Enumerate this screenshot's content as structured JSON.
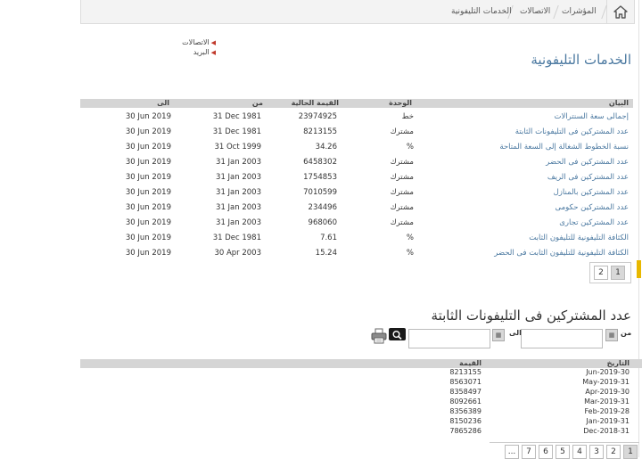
{
  "breadcrumb": {
    "items": [
      "المؤشرات",
      "الاتصالات",
      "الخدمات التليفونية"
    ]
  },
  "side_links": [
    "الاتصالات",
    "البريد"
  ],
  "page_title": "الخدمات التليفونية",
  "table": {
    "headers": {
      "item": "البيان",
      "unit": "الوحدة",
      "value": "القيمة الحالية",
      "from": "من",
      "to": "الى"
    },
    "rows": [
      {
        "item": "إجمالى سعة السنترالات",
        "unit": "خط",
        "value": "23974925",
        "from": "31 Dec 1981",
        "to": "30 Jun 2019"
      },
      {
        "item": "عدد المشتركين فى التليفونات الثابتة",
        "unit": "مشترك",
        "value": "8213155",
        "from": "31 Dec 1981",
        "to": "30 Jun 2019"
      },
      {
        "item": "نسبة الخطوط الشغالة إلى السعة المتاحة",
        "unit": "%",
        "value": "34.26",
        "from": "31 Oct 1999",
        "to": "30 Jun 2019"
      },
      {
        "item": "عدد المشتركين فى الحضر",
        "unit": "مشترك",
        "value": "6458302",
        "from": "31 Jan 2003",
        "to": "30 Jun 2019"
      },
      {
        "item": "عدد المشتركين فى الريف",
        "unit": "مشترك",
        "value": "1754853",
        "from": "31 Jan 2003",
        "to": "30 Jun 2019"
      },
      {
        "item": "عدد المشتركين بالمنازل",
        "unit": "مشترك",
        "value": "7010599",
        "from": "31 Jan 2003",
        "to": "30 Jun 2019"
      },
      {
        "item": "عدد المشتركين حكومى",
        "unit": "مشترك",
        "value": "234496",
        "from": "31 Jan 2003",
        "to": "30 Jun 2019"
      },
      {
        "item": "عدد المشتركين تجارى",
        "unit": "مشترك",
        "value": "968060",
        "from": "31 Jan 2003",
        "to": "30 Jun 2019"
      },
      {
        "item": "الكثافة التليفونية للتليفون الثابت",
        "unit": "%",
        "value": "7.61",
        "from": "31 Dec 1981",
        "to": "30 Jun 2019"
      },
      {
        "item": "الكثافة التليفونية للتليفون الثابت فى الحضر",
        "unit": "%",
        "value": "15.24",
        "from": "30 Apr 2003",
        "to": "30 Jun 2019"
      }
    ],
    "pages": [
      "1",
      "2"
    ]
  },
  "detail": {
    "title": "عدد المشتركين فى التليفونات الثابتة",
    "from_label": "من",
    "to_label": "الى",
    "from_value": "",
    "to_value": "",
    "headers": {
      "date": "التاريخ",
      "value": "القيمة"
    },
    "rows": [
      {
        "date": "Jun-2019-30",
        "value": "8213155"
      },
      {
        "date": "May-2019-31",
        "value": "8563071"
      },
      {
        "date": "Apr-2019-30",
        "value": "8358497"
      },
      {
        "date": "Mar-2019-31",
        "value": "8092661"
      },
      {
        "date": "Feb-2019-28",
        "value": "8356389"
      },
      {
        "date": "Jan-2019-31",
        "value": "8150236"
      },
      {
        "date": "Dec-2018-31",
        "value": "7865286"
      }
    ],
    "pages": [
      "1",
      "2",
      "3",
      "4",
      "5",
      "6",
      "7",
      "..."
    ]
  },
  "colors": {
    "link": "#4a78a0",
    "header_bg": "#d5d5d5",
    "accent": "#e8b800"
  },
  "icons": [
    "home-icon",
    "calendar-icon",
    "search-icon",
    "print-icon"
  ]
}
